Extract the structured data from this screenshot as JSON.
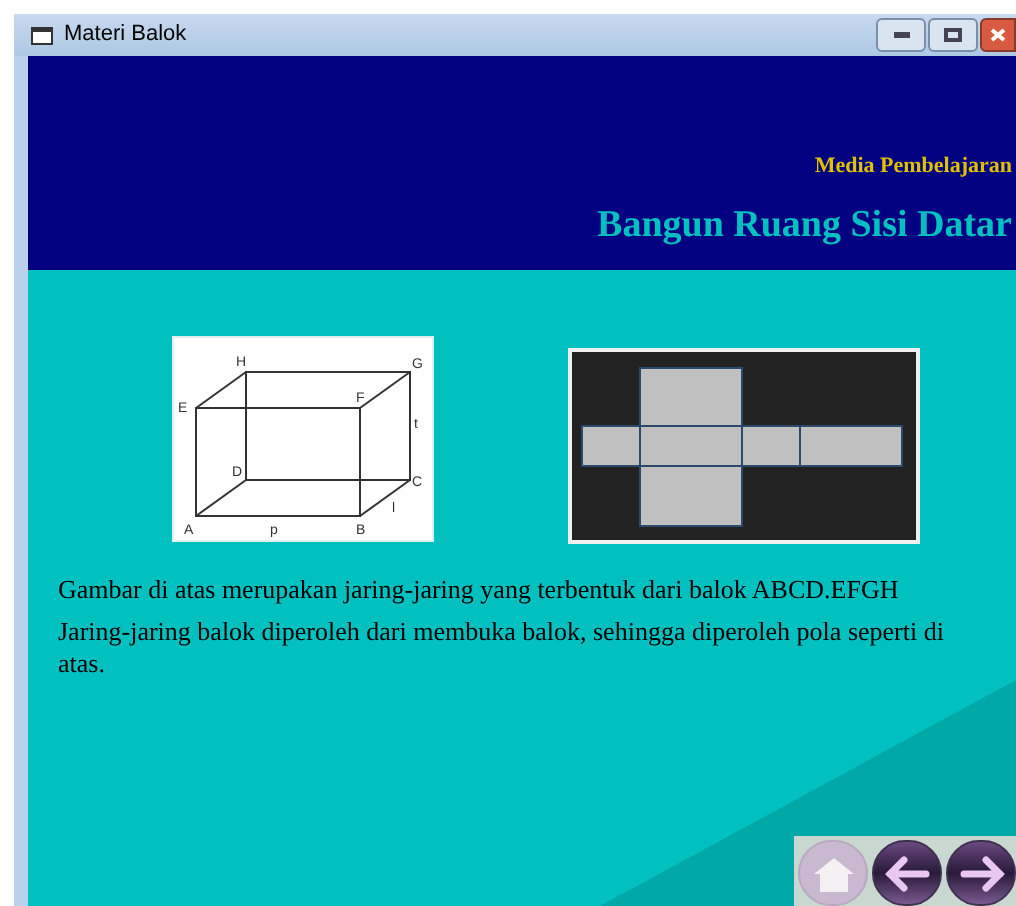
{
  "window": {
    "title": "Materi Balok"
  },
  "header": {
    "subtitle": "Media Pembelajaran",
    "title": "Bangun Ruang Sisi Datar"
  },
  "cuboid_labels": {
    "h": "H",
    "g": "G",
    "e": "E",
    "f": "F",
    "t": "t",
    "d": "D",
    "c": "C",
    "a": "A",
    "p": "p",
    "b": "B",
    "l": "l"
  },
  "paragraphs": [
    "Gambar di atas merupakan jaring-jaring yang terbentuk dari balok ABCD.EFGH",
    "Jaring-jaring balok diperoleh dari membuka balok, sehingga diperoleh pola seperti di atas."
  ],
  "nav_buttons": [
    {
      "kind": "home",
      "disabled": true
    },
    {
      "kind": "back",
      "disabled": false
    },
    {
      "kind": "forward",
      "disabled": false
    }
  ]
}
